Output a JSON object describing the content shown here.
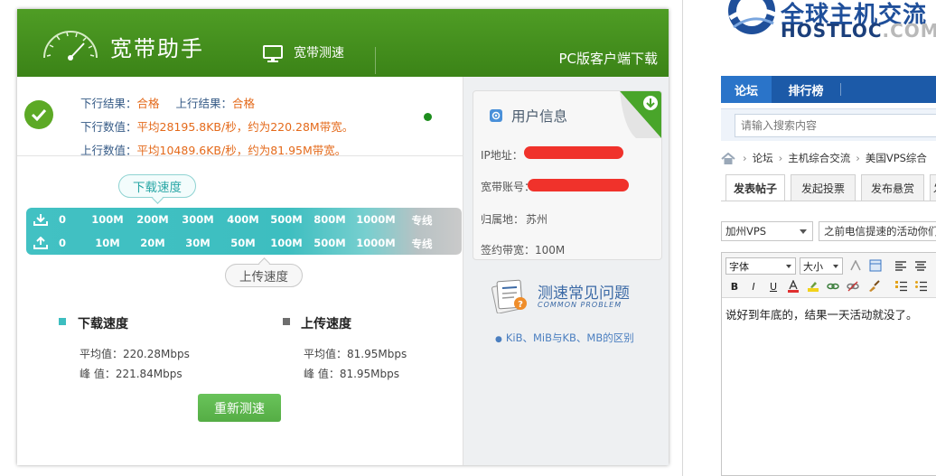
{
  "app": {
    "title": "宽带助手",
    "speedtest_tab": "宽带测速",
    "pc_download": "PC版客户端下载"
  },
  "summary": {
    "down_result_label": "下行结果：",
    "down_result_value": "合格",
    "up_result_label": "上行结果：",
    "up_result_value": "合格",
    "down_value_label": "下行数值：",
    "down_value_text": "平均28195.8KB/秒，约为220.28M带宽。",
    "up_value_label": "上行数值：",
    "up_value_text": "平均10489.6KB/秒，约为81.95M带宽。"
  },
  "scale": {
    "download_bubble": "下载速度",
    "upload_bubble": "上传速度",
    "download_ticks": [
      "0",
      "100M",
      "200M",
      "300M",
      "400M",
      "500M",
      "800M",
      "1000M",
      "专线"
    ],
    "upload_ticks": [
      "0",
      "10M",
      "20M",
      "30M",
      "50M",
      "100M",
      "500M",
      "1000M",
      "专线"
    ]
  },
  "results": {
    "download": {
      "title": "下载速度",
      "avg": "平均值：220.28Mbps",
      "peak": "峰 值：221.84Mbps",
      "color": "#3dbec0"
    },
    "upload": {
      "title": "上传速度",
      "avg": "平均值：81.95Mbps",
      "peak": "峰 值：81.95Mbps",
      "color": "#6e6e6e"
    },
    "retest_button": "重新测速"
  },
  "user_info": {
    "title": "用户信息",
    "ip_label": "IP地址：",
    "account_label": "宽带账号：",
    "location_label": "归属地：",
    "location_value": "苏州",
    "bandwidth_label": "签约带宽：",
    "bandwidth_value": "100M"
  },
  "faq": {
    "title": "测速常见问题",
    "subtitle": "COMMON PROBLEM",
    "link": "KiB、MiB与KB、MB的区别"
  },
  "forum": {
    "logo_cn": "全球主机交流",
    "logo_en_bright": "HOSTLOC",
    "logo_en_dim": ".COM",
    "nav": [
      "论坛",
      "排行榜"
    ],
    "search_placeholder": "请输入搜索内容",
    "breadcrumb": [
      "论坛",
      "主机综合交流",
      "美国VPS综合"
    ],
    "post_tabs": [
      "发表帖子",
      "发起投票",
      "发布悬赏",
      "发"
    ],
    "category": "加州VPS",
    "title_value": "之前电信提速的活动你们",
    "toolbar": {
      "font": "字体",
      "size": "大小"
    },
    "editor_content": "说好到年底的，结果一天活动就没了。"
  },
  "colors": {
    "header_green": "#3f8a1b",
    "accent_orange": "#e46a1b",
    "label_blue": "#355a86",
    "scale_teal": "#42c1c3",
    "forum_blue": "#1c5aa8"
  }
}
